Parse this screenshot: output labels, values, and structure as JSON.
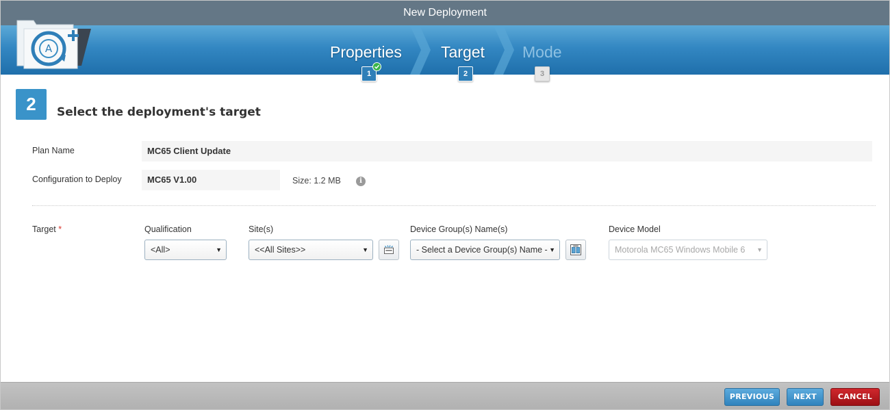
{
  "window": {
    "title": "New Deployment"
  },
  "wizard": {
    "steps": [
      {
        "label": "Properties",
        "number": "1",
        "state": "complete"
      },
      {
        "label": "Target",
        "number": "2",
        "state": "active"
      },
      {
        "label": "Mode",
        "number": "3",
        "state": "disabled"
      }
    ]
  },
  "section": {
    "number": "2",
    "title": "Select the deployment's target"
  },
  "plan": {
    "label": "Plan Name",
    "value": "MC65 Client Update"
  },
  "config": {
    "label": "Configuration to Deploy",
    "value": "MC65 V1.00",
    "size": "Size: 1.2 MB"
  },
  "target": {
    "label": "Target",
    "required_mark": "*",
    "qualification": {
      "label": "Qualification",
      "value": "<All>"
    },
    "sites": {
      "label": "Site(s)",
      "value": "<<All Sites>>"
    },
    "device_groups": {
      "label": "Device Group(s) Name(s)",
      "value": "- Select a Device Group(s) Name -"
    },
    "device_model": {
      "label": "Device Model",
      "value": "Motorola MC65 Windows Mobile 6"
    }
  },
  "footer": {
    "previous": "PREVIOUS",
    "next": "NEXT",
    "cancel": "CANCEL"
  },
  "colors": {
    "accent": "#3a93c9",
    "titlebar": "#647786",
    "cancel": "#b81a20",
    "check": "#3bb54a"
  },
  "icons": {
    "info": "info-icon",
    "sites_picker": "site-browse-icon",
    "groups_picker": "device-group-browse-icon",
    "check": "check-icon"
  }
}
